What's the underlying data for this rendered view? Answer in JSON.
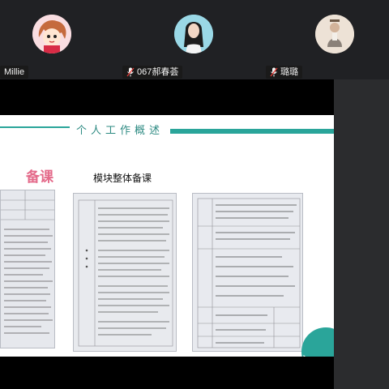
{
  "participants": [
    {
      "name": "Millie",
      "muted": false,
      "avatar": "cartoon-girl-avatar"
    },
    {
      "name": "067郝春荟",
      "muted": true,
      "avatar": "girl-portrait-avatar"
    },
    {
      "name": "璐璐",
      "muted": true,
      "avatar": "figure-photo-avatar"
    }
  ],
  "slide": {
    "title": "个人工作概述",
    "section_label": "备课",
    "subtitle": "模块整体备课"
  },
  "colors": {
    "accent": "#2aa59a",
    "pink": "#e46a8a",
    "background": "#202124"
  }
}
